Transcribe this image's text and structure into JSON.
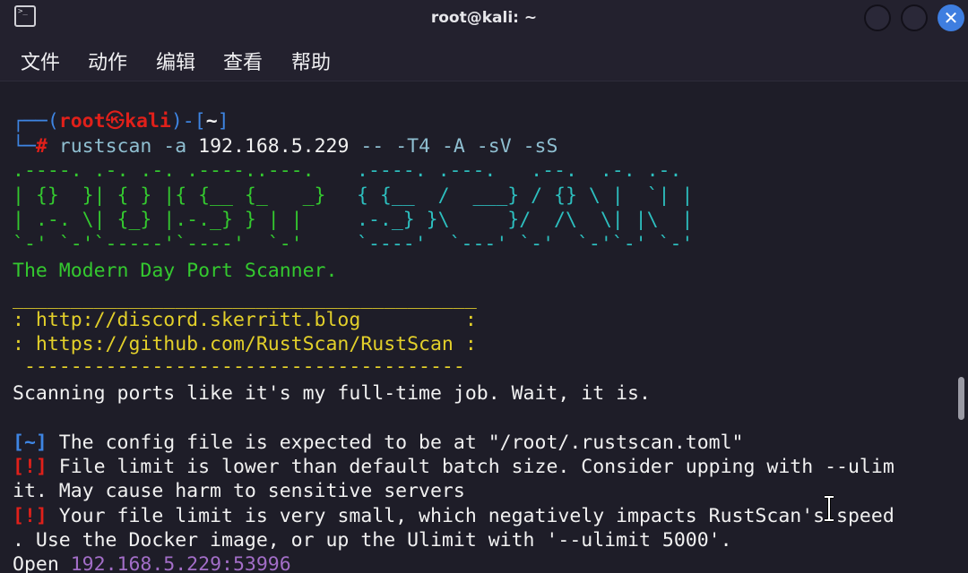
{
  "window": {
    "title": "root@kali: ~",
    "icon": "terminal-icon",
    "close_glyph": "✕"
  },
  "menu": {
    "items": [
      "文件",
      "动作",
      "编辑",
      "查看",
      "帮助"
    ]
  },
  "prompt": {
    "box_top": "┌──(",
    "user": "root",
    "skull": "㉿",
    "host": "kali",
    "dir_open": ")-[",
    "dir": "~",
    "dir_close": "]",
    "box_bottom": "└─",
    "hash": "#",
    "command": "rustscan",
    "args_a": " -a ",
    "ip": "192.168.5.229",
    "args_rest": " -- -T4 -A -sV -sS"
  },
  "banner": {
    "green_lines": [
      ".----. .-. .-. .----..---.",
      "| {}  }| { } |{ {__ {_   _}",
      "| .-. \\| {_} |.-._} } | |",
      "`-' `-'`-----'`----'  `-'"
    ],
    "teal_lines": [
      ".----. .---.   .--.  .-. .-.",
      "{ {__  /  ___} / {} \\ |  `| |",
      ".-._} }\\     }/  /\\  \\| |\\  |",
      "`----'  `---' `-'  `-'`-' `-'"
    ],
    "tagline": "The Modern Day Port Scanner.",
    "rule_top": "________________________________________",
    "link1": ": http://discord.skerritt.blog         :",
    "link2": ": https://github.com/RustScan/RustScan :",
    "rule_bottom": " --------------------------------------",
    "motto": "Scanning ports like it's my full-time job. Wait, it is."
  },
  "messages": [
    {
      "tag": "[~]",
      "text": " The config file is expected to be at \"/root/.rustscan.toml\""
    },
    {
      "tag": "[!]",
      "text": " File limit is lower than default batch size. Consider upping with --ulim"
    },
    {
      "tag": "",
      "text": "it. May cause harm to sensitive servers"
    },
    {
      "tag": "[!]",
      "text": " Your file limit is very small, which negatively impacts RustScan's speed"
    },
    {
      "tag": "",
      "text": ". Use the Docker image, or up the Ulimit with '--ulimit 5000'."
    }
  ],
  "open": {
    "label": "Open ",
    "address": "192.168.5.229:53996"
  },
  "colors": {
    "background": "#1e1d28",
    "blue": "#3e85e3",
    "red": "#e0201a",
    "green": "#34c92f",
    "yellow": "#e3d02a",
    "teal": "#2dbfbf",
    "purple": "#a36ec8"
  }
}
